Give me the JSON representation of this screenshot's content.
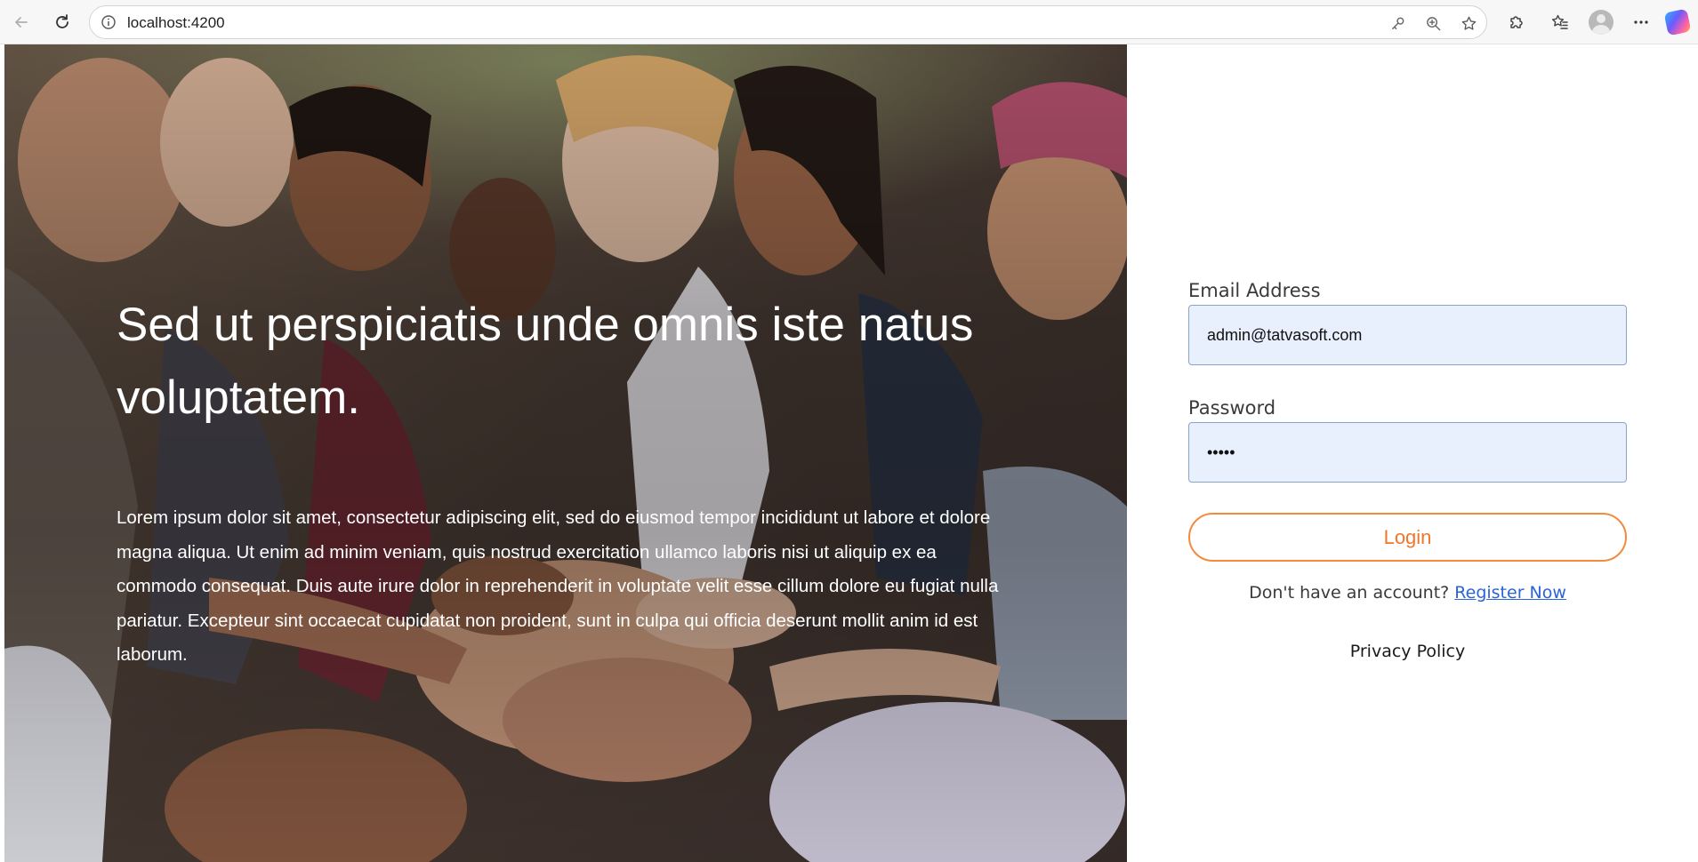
{
  "browser": {
    "url": "localhost:4200",
    "icons": {
      "back": "back-arrow-icon",
      "refresh": "refresh-icon",
      "site_info": "info-icon",
      "password": "key-icon",
      "zoom": "zoom-in-icon",
      "favorite": "star-icon",
      "extensions": "puzzle-icon",
      "favorites_bar": "favorites-icon",
      "profile": "profile-avatar-icon",
      "menu": "more-icon",
      "copilot": "copilot-icon"
    }
  },
  "hero": {
    "title": "Sed ut perspiciatis unde omnis iste natus voluptatem.",
    "description": "Lorem ipsum dolor sit amet, consectetur adipiscing elit, sed do eiusmod tempor incididunt ut labore et dolore magna aliqua. Ut enim ad minim veniam, quis nostrud exercitation ullamco laboris nisi ut aliquip ex ea commodo consequat. Duis aute irure dolor in reprehenderit in voluptate velit esse cillum dolore eu fugiat nulla pariatur. Excepteur sint occaecat cupidatat non proident, sunt in culpa qui officia deserunt mollit anim id est laborum."
  },
  "login_form": {
    "email_label": "Email Address",
    "email_value": "admin@tatvasoft.com",
    "password_label": "Password",
    "password_value": "•••••",
    "login_button": "Login",
    "register_prompt": "Don't have an account?",
    "register_link": "Register Now",
    "privacy_link": "Privacy Policy"
  },
  "colors": {
    "accent_orange": "#f38b3d",
    "link_blue": "#2b63d9",
    "input_background": "#e8f0fe"
  }
}
